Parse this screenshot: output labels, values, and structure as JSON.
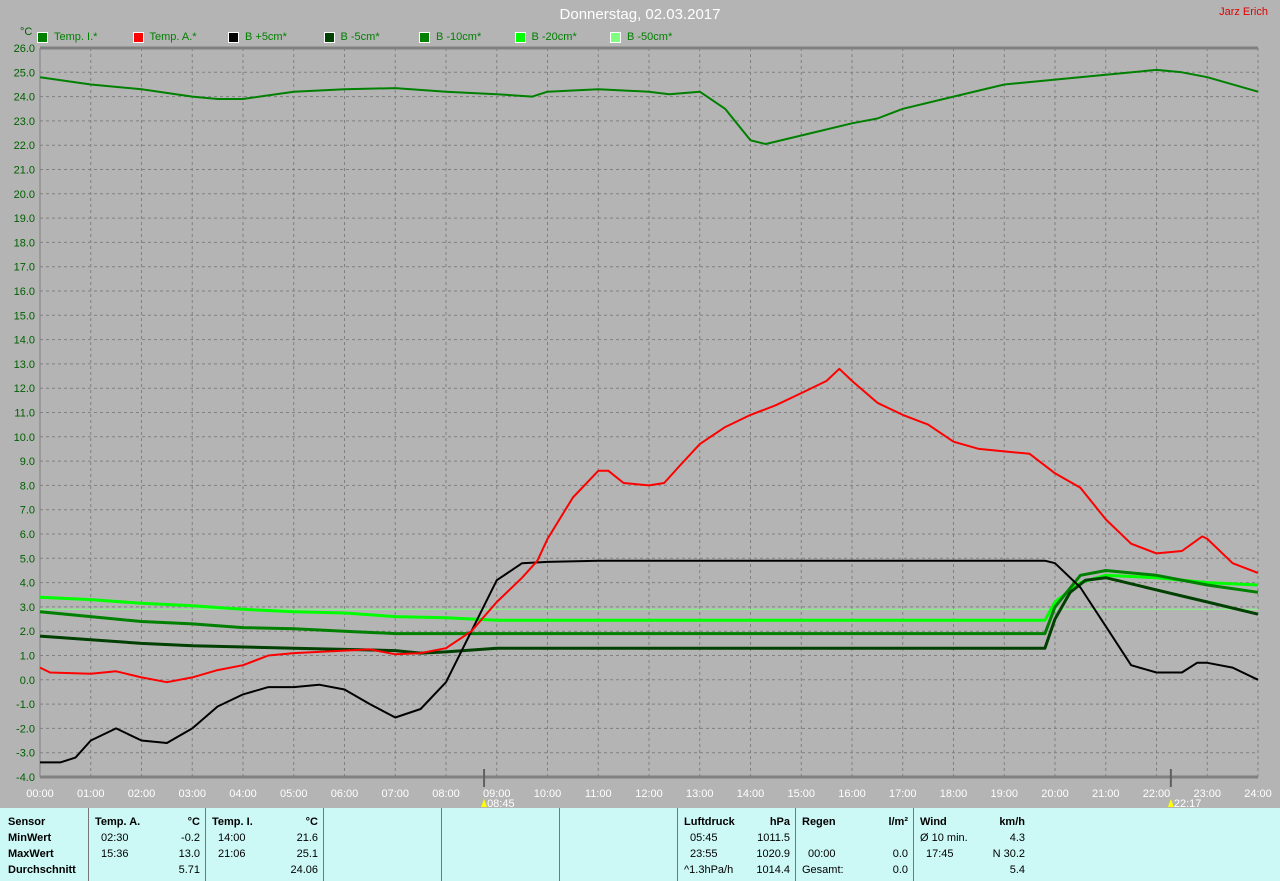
{
  "header": {
    "title": "Donnerstag, 02.03.2017",
    "author": "Jarz Erich",
    "unit": "°C"
  },
  "chart_data": {
    "type": "line",
    "title": "Donnerstag, 02.03.2017",
    "ylabel": "°C",
    "xlim": [
      0,
      24
    ],
    "ylim": [
      -4,
      26
    ],
    "grid": true,
    "x_ticks": [
      "00:00",
      "01:00",
      "02:00",
      "03:00",
      "04:00",
      "05:00",
      "06:00",
      "07:00",
      "08:00",
      "09:00",
      "10:00",
      "11:00",
      "12:00",
      "13:00",
      "14:00",
      "15:00",
      "16:00",
      "17:00",
      "18:00",
      "19:00",
      "20:00",
      "21:00",
      "22:00",
      "23:00",
      "24:00"
    ],
    "y_ticks": [
      "26.0",
      "25.0",
      "24.0",
      "23.0",
      "22.0",
      "21.0",
      "20.0",
      "19.0",
      "18.0",
      "17.0",
      "16.0",
      "15.0",
      "14.0",
      "13.0",
      "12.0",
      "11.0",
      "10.0",
      "9.0",
      "8.0",
      "7.0",
      "6.0",
      "5.0",
      "4.0",
      "3.0",
      "2.0",
      "1.0",
      "0.0",
      "-1.0",
      "-2.0",
      "-3.0",
      "-4.0"
    ],
    "markers": [
      {
        "label": "08:45",
        "x": 8.75
      },
      {
        "label": "22:17",
        "x": 22.283
      }
    ],
    "series": [
      {
        "name": "Temp. I.*",
        "color": "#008000",
        "width": 2,
        "points": [
          [
            0,
            24.8
          ],
          [
            1,
            24.5
          ],
          [
            2,
            24.3
          ],
          [
            3,
            24.0
          ],
          [
            3.5,
            23.9
          ],
          [
            4,
            23.9
          ],
          [
            5,
            24.2
          ],
          [
            6,
            24.3
          ],
          [
            7,
            24.35
          ],
          [
            8,
            24.2
          ],
          [
            9,
            24.1
          ],
          [
            9.7,
            24.0
          ],
          [
            10,
            24.2
          ],
          [
            11,
            24.3
          ],
          [
            12,
            24.2
          ],
          [
            12.4,
            24.1
          ],
          [
            13,
            24.2
          ],
          [
            13.5,
            23.5
          ],
          [
            14,
            22.2
          ],
          [
            14.3,
            22.05
          ],
          [
            15,
            22.4
          ],
          [
            16,
            22.9
          ],
          [
            16.5,
            23.1
          ],
          [
            17,
            23.5
          ],
          [
            18,
            24.0
          ],
          [
            19,
            24.5
          ],
          [
            20,
            24.7
          ],
          [
            21,
            24.9
          ],
          [
            22,
            25.1
          ],
          [
            22.5,
            25.0
          ],
          [
            23,
            24.8
          ],
          [
            24,
            24.2
          ]
        ]
      },
      {
        "name": "Temp. A.*",
        "color": "#ff0000",
        "width": 2,
        "points": [
          [
            0,
            0.5
          ],
          [
            0.2,
            0.3
          ],
          [
            1,
            0.25
          ],
          [
            1.5,
            0.35
          ],
          [
            2,
            0.1
          ],
          [
            2.5,
            -0.1
          ],
          [
            3,
            0.1
          ],
          [
            3.5,
            0.4
          ],
          [
            4,
            0.6
          ],
          [
            4.5,
            1.0
          ],
          [
            5,
            1.1
          ],
          [
            5.5,
            1.15
          ],
          [
            6,
            1.2
          ],
          [
            6.5,
            1.25
          ],
          [
            7,
            1.05
          ],
          [
            7.5,
            1.1
          ],
          [
            8,
            1.3
          ],
          [
            8.5,
            2.0
          ],
          [
            9,
            3.2
          ],
          [
            9.5,
            4.2
          ],
          [
            9.8,
            4.9
          ],
          [
            10,
            5.8
          ],
          [
            10.5,
            7.5
          ],
          [
            11,
            8.6
          ],
          [
            11.2,
            8.6
          ],
          [
            11.5,
            8.1
          ],
          [
            12,
            8.0
          ],
          [
            12.3,
            8.1
          ],
          [
            12.6,
            8.8
          ],
          [
            13,
            9.7
          ],
          [
            13.5,
            10.4
          ],
          [
            14,
            10.9
          ],
          [
            14.5,
            11.3
          ],
          [
            15,
            11.8
          ],
          [
            15.5,
            12.3
          ],
          [
            15.75,
            12.8
          ],
          [
            16,
            12.3
          ],
          [
            16.5,
            11.4
          ],
          [
            17,
            10.9
          ],
          [
            17.5,
            10.5
          ],
          [
            18,
            9.8
          ],
          [
            18.5,
            9.5
          ],
          [
            19,
            9.4
          ],
          [
            19.5,
            9.3
          ],
          [
            20,
            8.5
          ],
          [
            20.5,
            7.9
          ],
          [
            21,
            6.6
          ],
          [
            21.5,
            5.6
          ],
          [
            22,
            5.2
          ],
          [
            22.5,
            5.3
          ],
          [
            22.9,
            5.9
          ],
          [
            23,
            5.8
          ],
          [
            23.5,
            4.8
          ],
          [
            24,
            4.4
          ]
        ]
      },
      {
        "name": "B +5cm*",
        "color": "#000000",
        "width": 2,
        "points": [
          [
            0,
            -3.4
          ],
          [
            0.4,
            -3.4
          ],
          [
            0.7,
            -3.2
          ],
          [
            1,
            -2.5
          ],
          [
            1.5,
            -2.0
          ],
          [
            2,
            -2.5
          ],
          [
            2.5,
            -2.6
          ],
          [
            3,
            -2.0
          ],
          [
            3.5,
            -1.1
          ],
          [
            4,
            -0.6
          ],
          [
            4.5,
            -0.3
          ],
          [
            5,
            -0.3
          ],
          [
            5.5,
            -0.2
          ],
          [
            6,
            -0.4
          ],
          [
            6.5,
            -1.0
          ],
          [
            7,
            -1.55
          ],
          [
            7.5,
            -1.2
          ],
          [
            8,
            -0.1
          ],
          [
            8.5,
            2.0
          ],
          [
            9,
            4.1
          ],
          [
            9.5,
            4.8
          ],
          [
            10,
            4.85
          ],
          [
            11,
            4.9
          ],
          [
            19.8,
            4.9
          ],
          [
            20,
            4.8
          ],
          [
            20.5,
            3.8
          ],
          [
            21,
            2.2
          ],
          [
            21.5,
            0.6
          ],
          [
            22,
            0.3
          ],
          [
            22.5,
            0.3
          ],
          [
            22.8,
            0.7
          ],
          [
            23,
            0.7
          ],
          [
            23.5,
            0.5
          ],
          [
            24,
            0.0
          ]
        ]
      },
      {
        "name": "B -5cm*",
        "color": "#004000",
        "width": 3,
        "points": [
          [
            0,
            1.8
          ],
          [
            1,
            1.65
          ],
          [
            2,
            1.5
          ],
          [
            3,
            1.4
          ],
          [
            5,
            1.3
          ],
          [
            6,
            1.25
          ],
          [
            7,
            1.2
          ],
          [
            7.5,
            1.1
          ],
          [
            8,
            1.15
          ],
          [
            9,
            1.3
          ],
          [
            19.8,
            1.3
          ],
          [
            20,
            2.5
          ],
          [
            20.3,
            3.6
          ],
          [
            20.6,
            4.1
          ],
          [
            21,
            4.2
          ],
          [
            22,
            3.7
          ],
          [
            23,
            3.2
          ],
          [
            24,
            2.7
          ]
        ]
      },
      {
        "name": "B -10cm*",
        "color": "#008000",
        "width": 3,
        "points": [
          [
            0,
            2.8
          ],
          [
            1,
            2.6
          ],
          [
            2,
            2.4
          ],
          [
            3,
            2.3
          ],
          [
            4,
            2.15
          ],
          [
            5,
            2.1
          ],
          [
            6,
            2.0
          ],
          [
            7,
            1.9
          ],
          [
            19.8,
            1.9
          ],
          [
            20,
            3.0
          ],
          [
            20.5,
            4.3
          ],
          [
            21,
            4.5
          ],
          [
            22,
            4.3
          ],
          [
            23,
            3.9
          ],
          [
            24,
            3.6
          ]
        ]
      },
      {
        "name": "B -20cm*",
        "color": "#00ff00",
        "width": 3,
        "points": [
          [
            0,
            3.4
          ],
          [
            1,
            3.3
          ],
          [
            2,
            3.15
          ],
          [
            3,
            3.05
          ],
          [
            4,
            2.9
          ],
          [
            5,
            2.8
          ],
          [
            6,
            2.75
          ],
          [
            7,
            2.6
          ],
          [
            8,
            2.55
          ],
          [
            9,
            2.45
          ],
          [
            19.8,
            2.45
          ],
          [
            20,
            3.2
          ],
          [
            20.5,
            4.0
          ],
          [
            21,
            4.3
          ],
          [
            22,
            4.2
          ],
          [
            23,
            4.0
          ],
          [
            24,
            3.9
          ]
        ]
      },
      {
        "name": "B -50cm*",
        "color": "#80ff80",
        "width": 1,
        "points": [
          [
            0,
            2.9
          ],
          [
            24,
            2.9
          ]
        ]
      }
    ]
  },
  "table": {
    "temp_a": {
      "h_sensor": "Sensor",
      "h_name": "Temp. A.",
      "h_unit": "°C",
      "min_label": "MinWert",
      "max_label": "MaxWert",
      "avg_label": "Durchschnitt",
      "min_time": "02:30",
      "min_val": "-0.2",
      "max_time": "15:36",
      "max_val": "13.0",
      "avg_val": "5.71"
    },
    "temp_i": {
      "h_name": "Temp. I.",
      "h_unit": "°C",
      "min_time": "14:00",
      "min_val": "21.6",
      "max_time": "21:06",
      "max_val": "25.1",
      "avg_val": "24.06"
    },
    "pressure": {
      "h_name": "Luftdruck",
      "h_unit": "hPa",
      "min_time": "05:45",
      "min_val": "1011.5",
      "max_time": "23:55",
      "max_val": "1020.9",
      "trend": "^1.3hPa/h",
      "avg_val": "1014.4"
    },
    "rain": {
      "h_name": "Regen",
      "h_unit": "l/m²",
      "time": "00:00",
      "val": "0.0",
      "total_label": "Gesamt:",
      "total": "0.0"
    },
    "wind": {
      "h_name": "Wind",
      "h_unit": "km/h",
      "avg_label": "Ø 10 min.",
      "avg_val": "4.3",
      "gust_time": "17:45",
      "gust_val": "N 30.2",
      "mean": "5.4"
    }
  }
}
